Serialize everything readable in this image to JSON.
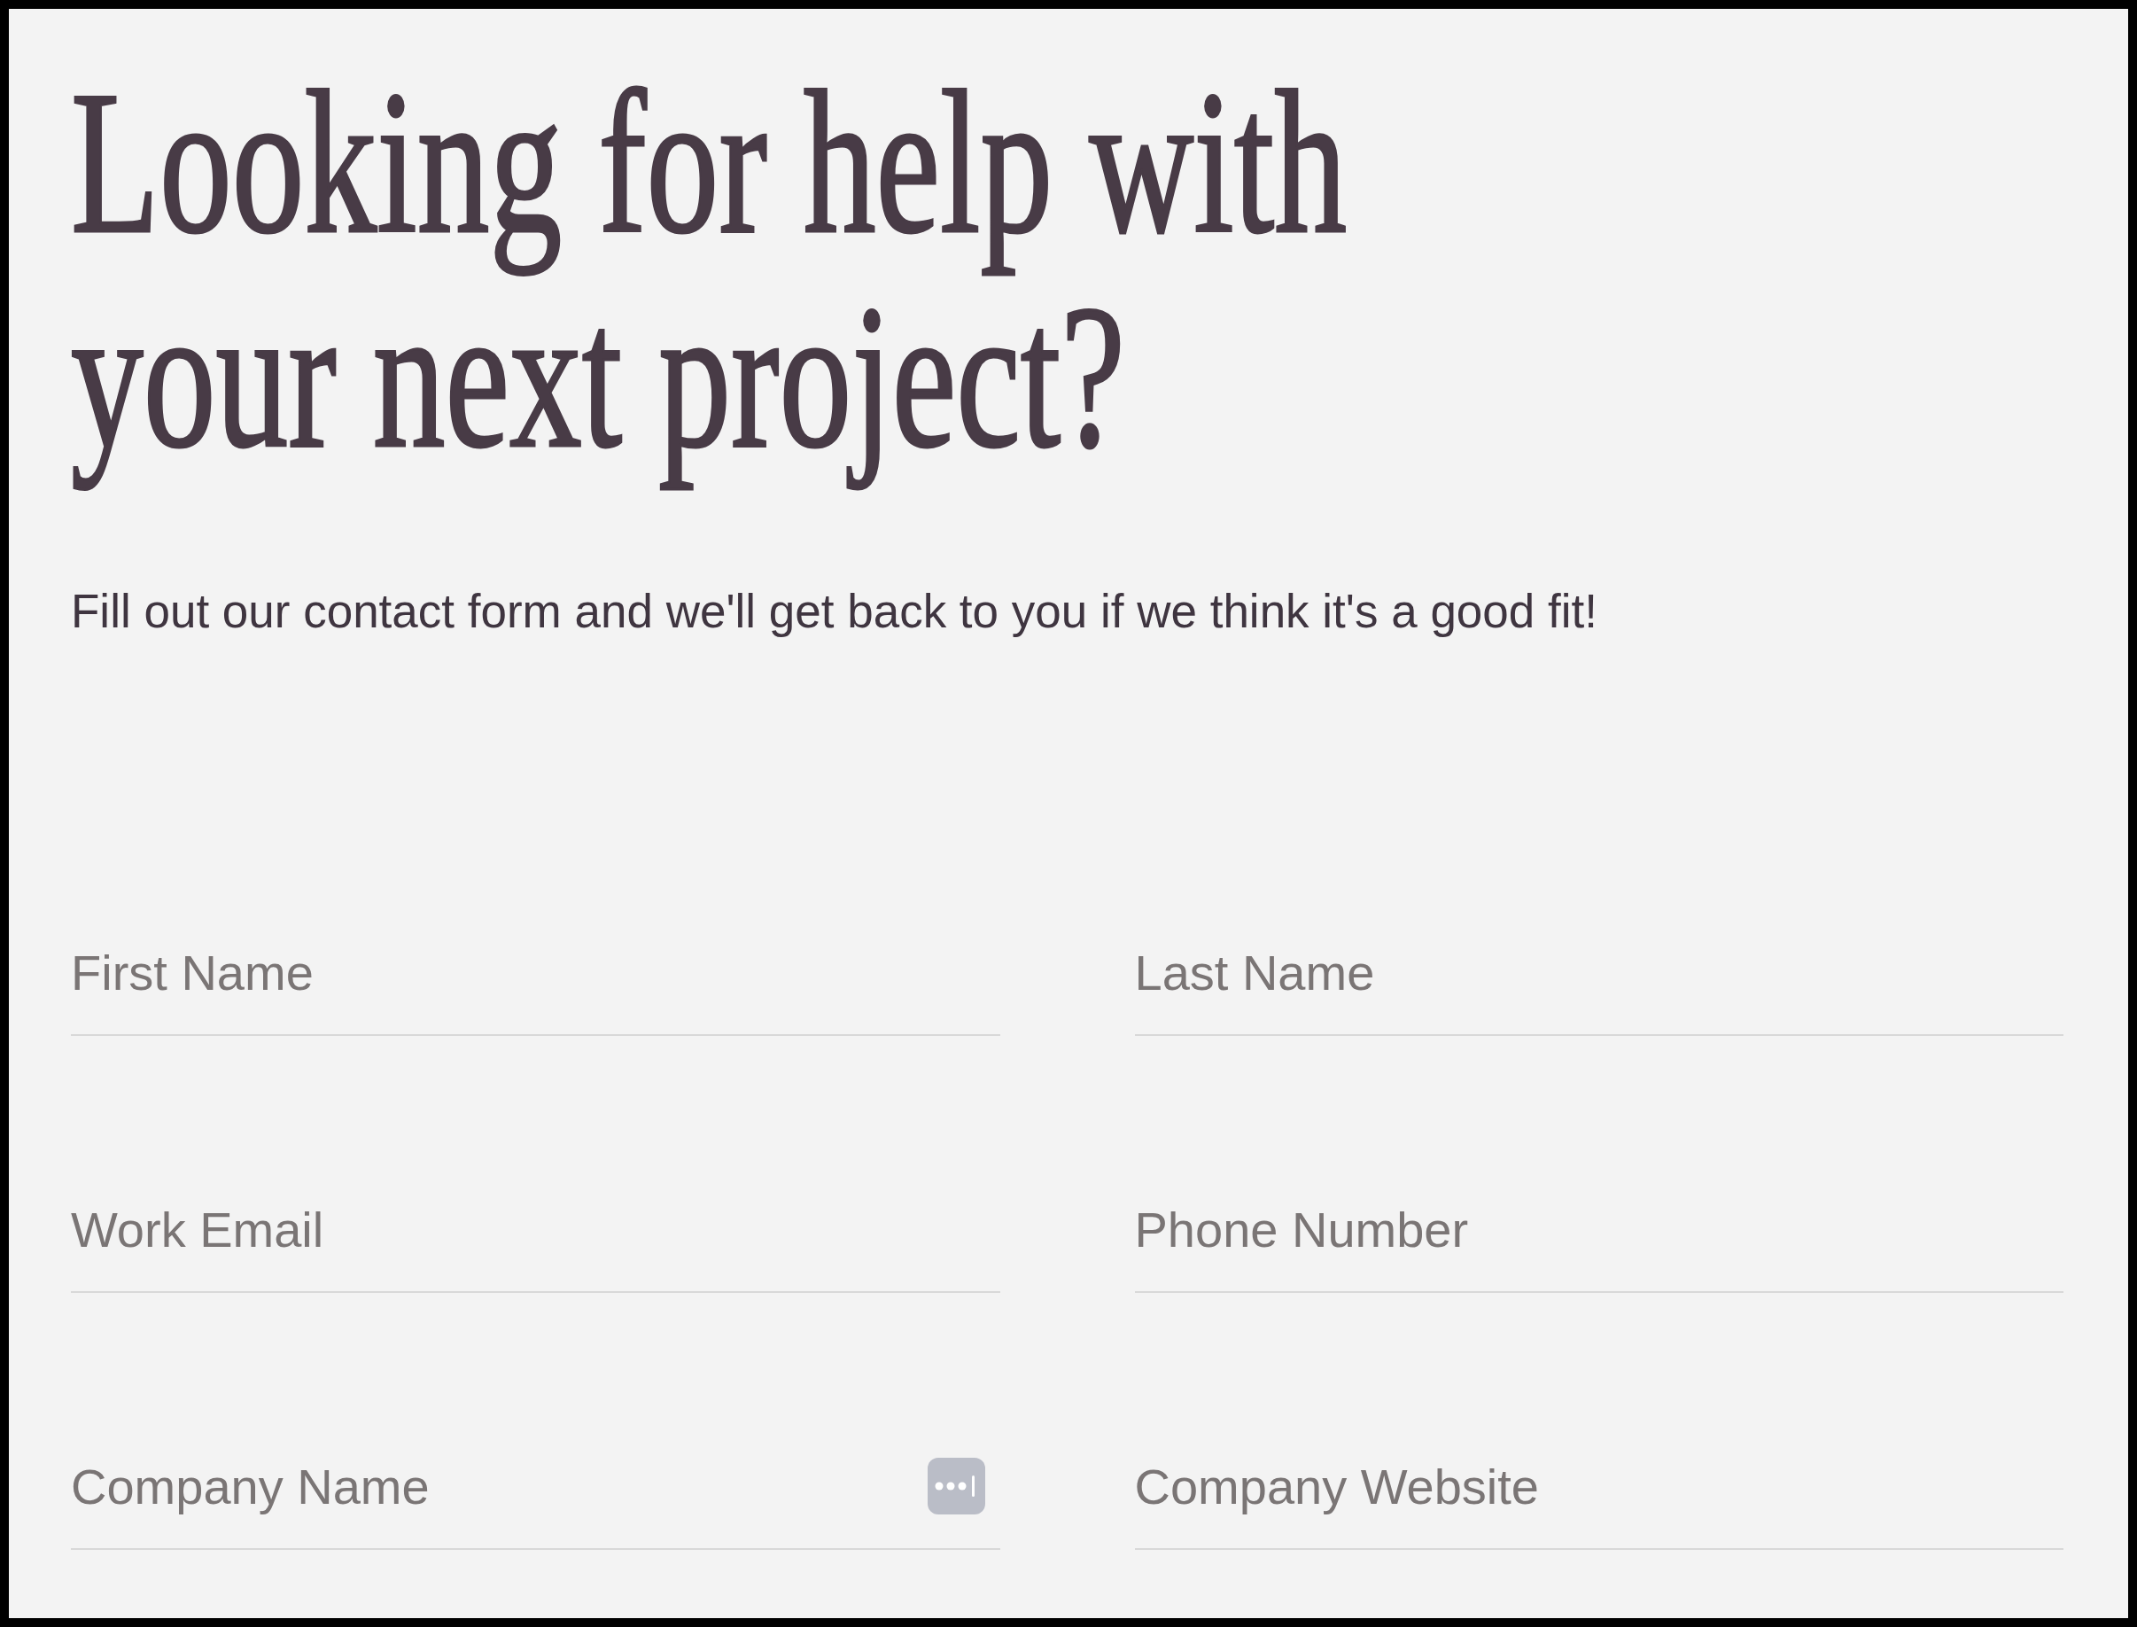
{
  "heading": "Looking for help with your next project?",
  "subtitle": "Fill out our contact form and we'll get back to you if we think it's a good fit!",
  "form": {
    "fields": [
      {
        "placeholder": "First Name",
        "autofill_icon": false
      },
      {
        "placeholder": "Last Name",
        "autofill_icon": false
      },
      {
        "placeholder": "Work Email",
        "autofill_icon": false
      },
      {
        "placeholder": "Phone Number",
        "autofill_icon": false
      },
      {
        "placeholder": "Company Name",
        "autofill_icon": true
      },
      {
        "placeholder": "Company Website",
        "autofill_icon": false
      }
    ]
  }
}
